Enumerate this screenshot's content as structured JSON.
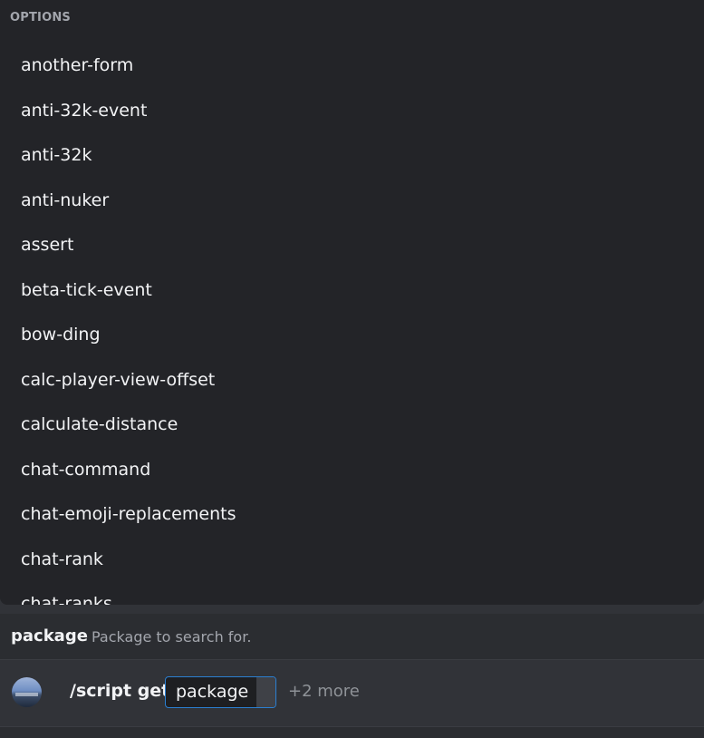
{
  "options_header": "OPTIONS",
  "options": [
    "another-form",
    "anti-32k-event",
    "anti-32k",
    "anti-nuker",
    "assert",
    "beta-tick-event",
    "bow-ding",
    "calc-player-view-offset",
    "calculate-distance",
    "chat-command",
    "chat-emoji-replacements",
    "chat-rank",
    "chat-ranks"
  ],
  "param_hint": {
    "name": "package",
    "description": "Package to search for."
  },
  "input": {
    "command": "/script get",
    "param_label": "package",
    "more": "+2 more"
  }
}
